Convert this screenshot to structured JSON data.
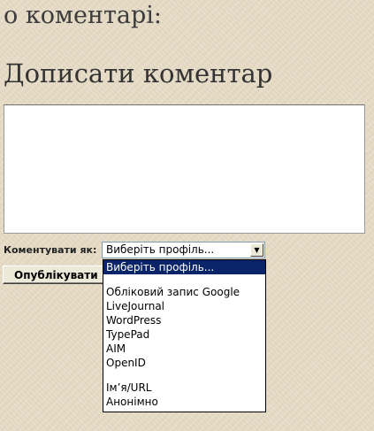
{
  "headings": {
    "top": "о коментарі:",
    "write_comment": "Дописати коментар"
  },
  "comment_form": {
    "textarea_value": "",
    "comment_as_label": "Коментувати як:",
    "profile_select": {
      "selected": "Виберіть профіль...",
      "arrow_icon": "chevron-down-icon"
    },
    "publish_button_label": "Опублікувати"
  },
  "dropdown": {
    "options": [
      "Виберіть профіль...",
      "",
      "Обліковий запис Google",
      "LiveJournal",
      "WordPress",
      "TypePad",
      "AIM",
      "OpenID",
      "",
      "Ім’я/URL",
      "Анонімно"
    ],
    "highlighted_index": 0
  },
  "colors": {
    "background": "#e7dcc6",
    "highlight": "#0a246a"
  }
}
